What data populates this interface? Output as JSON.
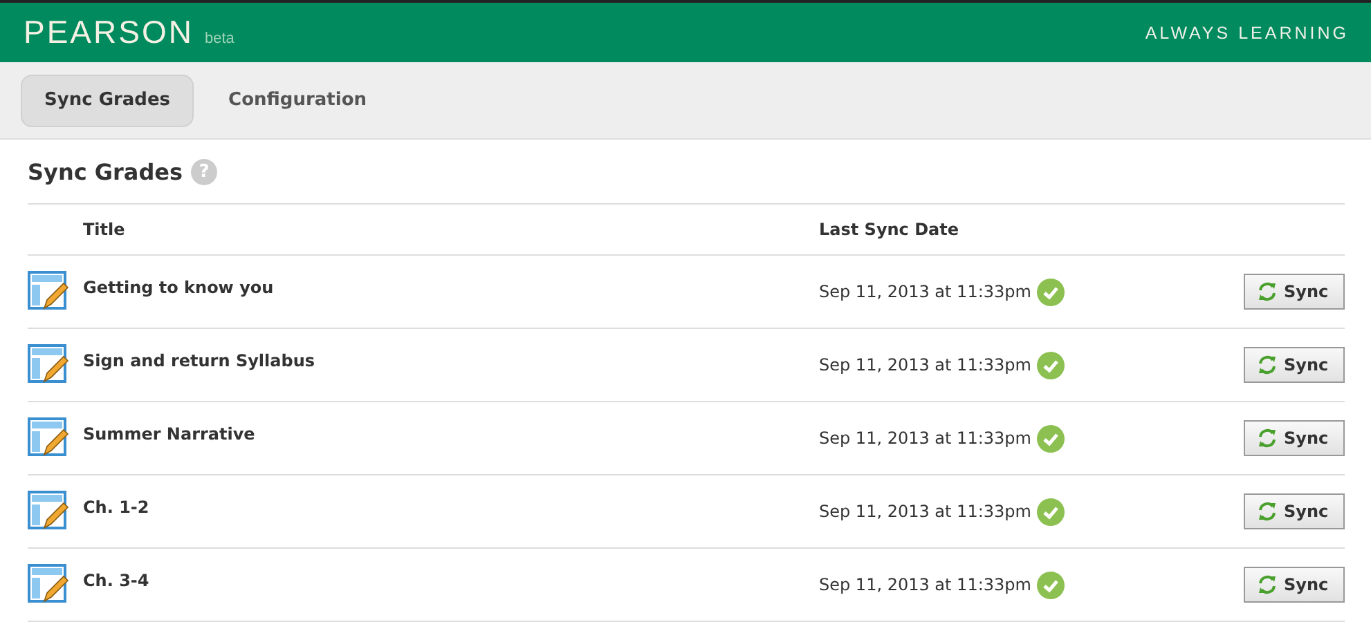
{
  "header": {
    "logo": "PEARSON",
    "badge": "beta",
    "tagline": "ALWAYS LEARNING"
  },
  "tabs": [
    {
      "label": "Sync Grades",
      "selected": true
    },
    {
      "label": "Configuration",
      "selected": false
    }
  ],
  "section": {
    "title": "Sync Grades",
    "help": "?"
  },
  "table": {
    "columns": [
      "Title",
      "Last Sync Date"
    ],
    "rows": [
      {
        "title": "Getting to know you",
        "last_sync": "Sep 11, 2013 at 11:33pm",
        "synced": true,
        "action": "Sync"
      },
      {
        "title": "Sign and return Syllabus",
        "last_sync": "Sep 11, 2013 at 11:33pm",
        "synced": true,
        "action": "Sync"
      },
      {
        "title": "Summer Narrative",
        "last_sync": "Sep 11, 2013 at 11:33pm",
        "synced": true,
        "action": "Sync"
      },
      {
        "title": "Ch. 1-2",
        "last_sync": "Sep 11, 2013 at 11:33pm",
        "synced": true,
        "action": "Sync"
      },
      {
        "title": "Ch. 3-4",
        "last_sync": "Sep 11, 2013 at 11:33pm",
        "synced": true,
        "action": "Sync"
      }
    ]
  }
}
